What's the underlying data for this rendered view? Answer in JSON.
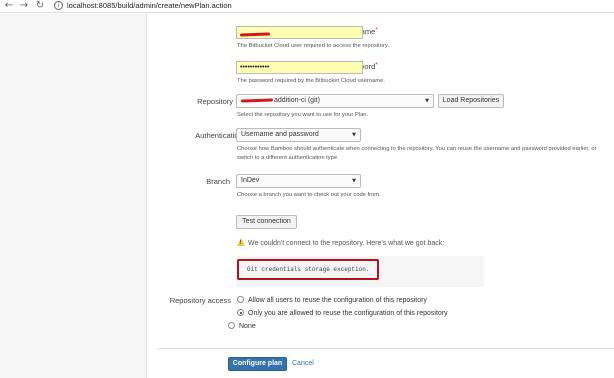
{
  "browser": {
    "url": "localhost:8085/build/admin/create/newPlan.action"
  },
  "form": {
    "username": {
      "label": "Username",
      "required_mark": "*",
      "help": "The Bitbucket Cloud user required to access the repository."
    },
    "password": {
      "label": "Password",
      "required_mark": "*",
      "value": "••••••••••••",
      "help": "The password required by the Bitbucket Cloud username."
    },
    "repository": {
      "label": "Repository",
      "selected_suffix": "addition-ci (git)",
      "help": "Select the repository you want to use for your Plan.",
      "load_button": "Load Repositories"
    },
    "auth_type": {
      "label": "Authentication type",
      "selected": "Username and password",
      "help_line1": "Choose how Bamboo should authenticate when connecting to the repository. You can reuse the username and password provided earlier, or",
      "help_line2": "switch to a different authentication type."
    },
    "branch": {
      "label": "Branch",
      "selected": "InDev",
      "help": "Choose a branch you want to check out your code from."
    },
    "test_button": "Test connection",
    "warning": "We couldn't connect to the repository. Here's what we got back:",
    "error_message": "Git credentials storage exception.",
    "repo_access": {
      "label": "Repository access",
      "options": [
        "Allow all users to reuse the configuration of this repository",
        "Only you are allowed to reuse the configuration of this repository",
        "None"
      ]
    },
    "configure_button": "Configure plan",
    "cancel_link": "Cancel"
  },
  "colors": {
    "accent": "#3572b0",
    "error_highlight": "#b3121a",
    "warning": "#f6c342",
    "autofill": "#ffffb3"
  }
}
